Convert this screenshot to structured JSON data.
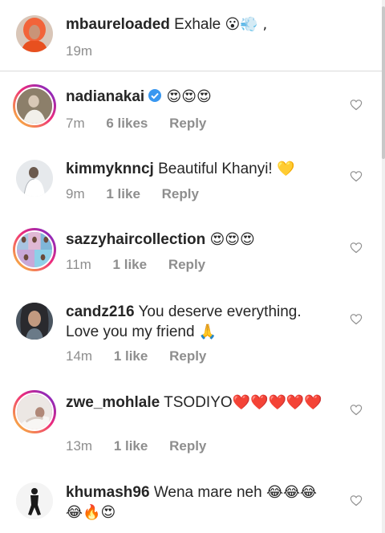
{
  "caption": {
    "username": "mbaureloaded",
    "text": "Exhale",
    "emoji": "😮💨 ,",
    "time": "19m"
  },
  "comments": [
    {
      "username": "nadianakai",
      "verified": true,
      "text": "",
      "emoji": "😍😍😍",
      "time": "7m",
      "likes": "6 likes",
      "reply": "Reply",
      "avatar_icon": "profile-photo-icon"
    },
    {
      "username": "kimmyknncj",
      "text": "Beautiful Khanyi!",
      "emoji": "💛",
      "time": "9m",
      "likes": "1 like",
      "reply": "Reply",
      "avatar_icon": "profile-photo-icon"
    },
    {
      "username": "sazzyhaircollection",
      "text": "",
      "emoji": "😍😍😍",
      "time": "11m",
      "likes": "1 like",
      "reply": "Reply",
      "avatar_icon": "profile-photo-icon"
    },
    {
      "username": "candz216",
      "text": "You deserve everything. Love you my friend",
      "emoji": "🙏",
      "time": "14m",
      "likes": "1 like",
      "reply": "Reply",
      "avatar_icon": "profile-photo-icon"
    },
    {
      "username": "zwe_mohlale",
      "text": "TSODIYO",
      "emoji": "❤️❤️❤️❤️❤️",
      "time": "13m",
      "likes": "1 like",
      "reply": "Reply",
      "avatar_icon": "profile-photo-icon"
    },
    {
      "username": "khumash96",
      "text": "Wena mare neh",
      "emoji": "😂😂😂😂🔥😍",
      "time": "",
      "likes": "",
      "reply": "",
      "avatar_icon": "profile-photo-icon"
    }
  ],
  "icons": {
    "like": "heart-outline-icon",
    "verified": "verified-badge-icon"
  },
  "colors": {
    "text": "#262626",
    "secondary": "#8e8e8e",
    "verified": "#3897f0",
    "story_ring_start": "#f9ce34",
    "story_ring_end": "#6228d7"
  }
}
